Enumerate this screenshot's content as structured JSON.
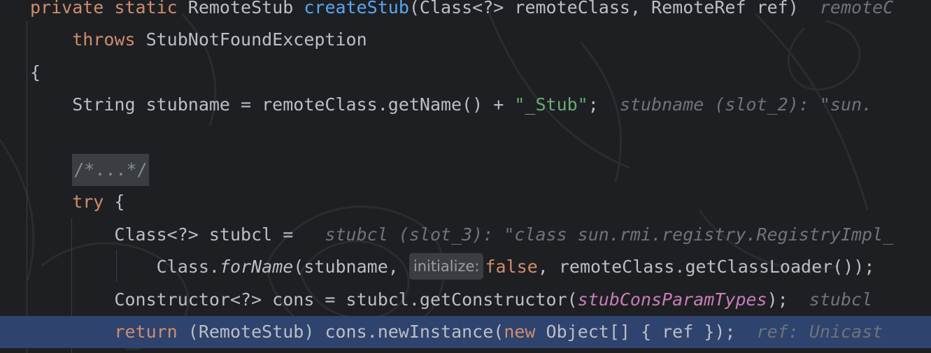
{
  "lines": [
    {
      "parts": [
        {
          "t": "private static ",
          "c": "kw"
        },
        {
          "t": "RemoteStub ",
          "c": ""
        },
        {
          "t": "createStub",
          "c": "fn"
        },
        {
          "t": "(Class<?> remoteClass, RemoteRef ref)",
          "c": ""
        },
        {
          "t": "  remoteC",
          "c": "hint"
        }
      ]
    },
    {
      "parts": [
        {
          "t": "    throws ",
          "c": "kw"
        },
        {
          "t": "StubNotFoundException",
          "c": ""
        }
      ]
    },
    {
      "parts": [
        {
          "t": "{",
          "c": ""
        }
      ]
    },
    {
      "parts": [
        {
          "t": "    String stubname = remoteClass.getName() + ",
          "c": ""
        },
        {
          "t": "\"_Stub\"",
          "c": "str"
        },
        {
          "t": ";",
          "c": ""
        },
        {
          "t": "  stubname (slot_2): \"sun.",
          "c": "hint"
        }
      ]
    },
    {
      "parts": []
    },
    {
      "parts": [
        {
          "t": "    ",
          "c": ""
        },
        {
          "t": "/*...*/",
          "c": "folded"
        }
      ]
    },
    {
      "parts": [
        {
          "t": "    try ",
          "c": "kw"
        },
        {
          "t": "{",
          "c": ""
        }
      ]
    },
    {
      "parts": [
        {
          "t": "        Class<?> stubcl = ",
          "c": ""
        },
        {
          "t": "  stubcl (slot_3): \"class sun.rmi.registry.RegistryImpl_",
          "c": "hint"
        }
      ]
    },
    {
      "parts": [
        {
          "t": "            Class.",
          "c": ""
        },
        {
          "t": "forName",
          "c": "italic"
        },
        {
          "t": "(stubname, ",
          "c": ""
        },
        {
          "t": "initialize:",
          "c": "param-hint"
        },
        {
          "t": "false",
          "c": "kw"
        },
        {
          "t": ", remoteClass.getClassLoader());",
          "c": ""
        }
      ]
    },
    {
      "parts": [
        {
          "t": "        Constructor<?> cons = stubcl.getConstructor(",
          "c": ""
        },
        {
          "t": "stubConsParamTypes",
          "c": "field"
        },
        {
          "t": ");",
          "c": ""
        },
        {
          "t": "  stubcl",
          "c": "hint"
        }
      ]
    },
    {
      "current": true,
      "parts": [
        {
          "t": "        return ",
          "c": "kw"
        },
        {
          "t": "(RemoteStub) cons.newInstance(",
          "c": ""
        },
        {
          "t": "new ",
          "c": "kw"
        },
        {
          "t": "Object[] { ref });",
          "c": ""
        },
        {
          "t": "  ref: Unicast",
          "c": "hint"
        }
      ]
    }
  ]
}
